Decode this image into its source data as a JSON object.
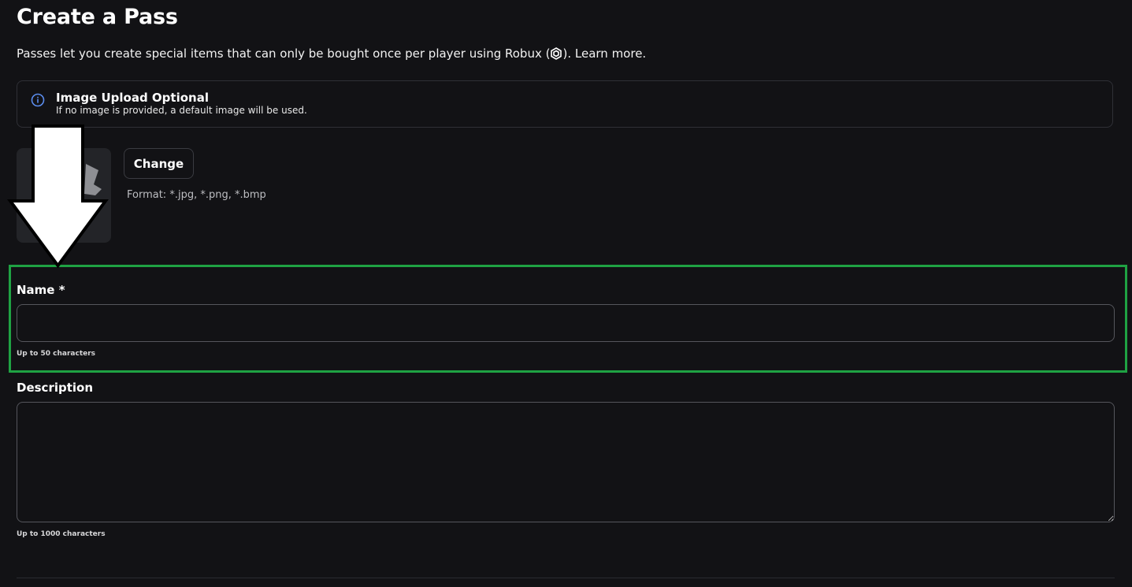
{
  "header": {
    "title": "Create a Pass",
    "subtitle_before": "Passes let you create special items that can only be bought once per player using Robux (",
    "subtitle_after": ").",
    "learn_more": "Learn more."
  },
  "info": {
    "title": "Image Upload Optional",
    "text": "If no image is provided, a default image will be used.",
    "icon": "info-circle-icon"
  },
  "image_upload": {
    "change_label": "Change",
    "format_text": "Format: *.jpg, *.png, *.bmp"
  },
  "form": {
    "name_label": "Name *",
    "name_value": "",
    "name_hint": "Up to 50 characters",
    "description_label": "Description",
    "description_value": "",
    "description_hint": "Up to 1000 characters"
  },
  "colors": {
    "background": "#121215",
    "highlight": "#1fa243",
    "info_icon": "#5b8def"
  }
}
